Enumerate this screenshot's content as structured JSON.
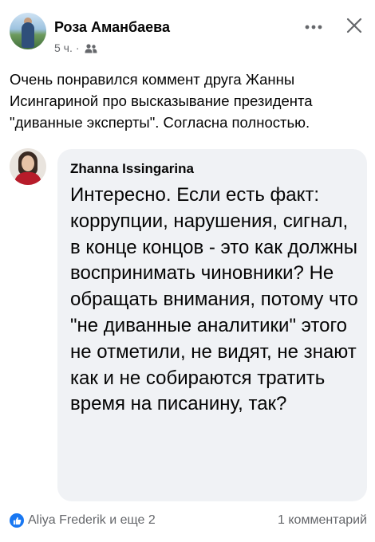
{
  "post": {
    "author": "Роза Аманбаева",
    "time": "5 ч.",
    "separator": "·",
    "audience_icon": "friends-icon",
    "text": "Очень понравился коммент друга Жанны Исингариной про высказывание  президента \"диванные эксперты\". Согласна полностью."
  },
  "comment": {
    "author": "Zhanna Issingarina",
    "text": "Интересно. Если есть факт: коррупции, нарушения, сигнал, в конце концов - это как должны воспринимать чиновники? Не обращать внимания, потому что \"не диванные аналитики\" этого не отметили, не видят, не знают как и не собираются тратить время на писанину, так?"
  },
  "footer": {
    "reactions_label": "Aliya Frederik и еще 2",
    "comments_label": "1 комментарий"
  },
  "colors": {
    "accent": "#1877f2",
    "secondary_text": "#65676b",
    "bubble_bg": "#f0f2f5"
  }
}
